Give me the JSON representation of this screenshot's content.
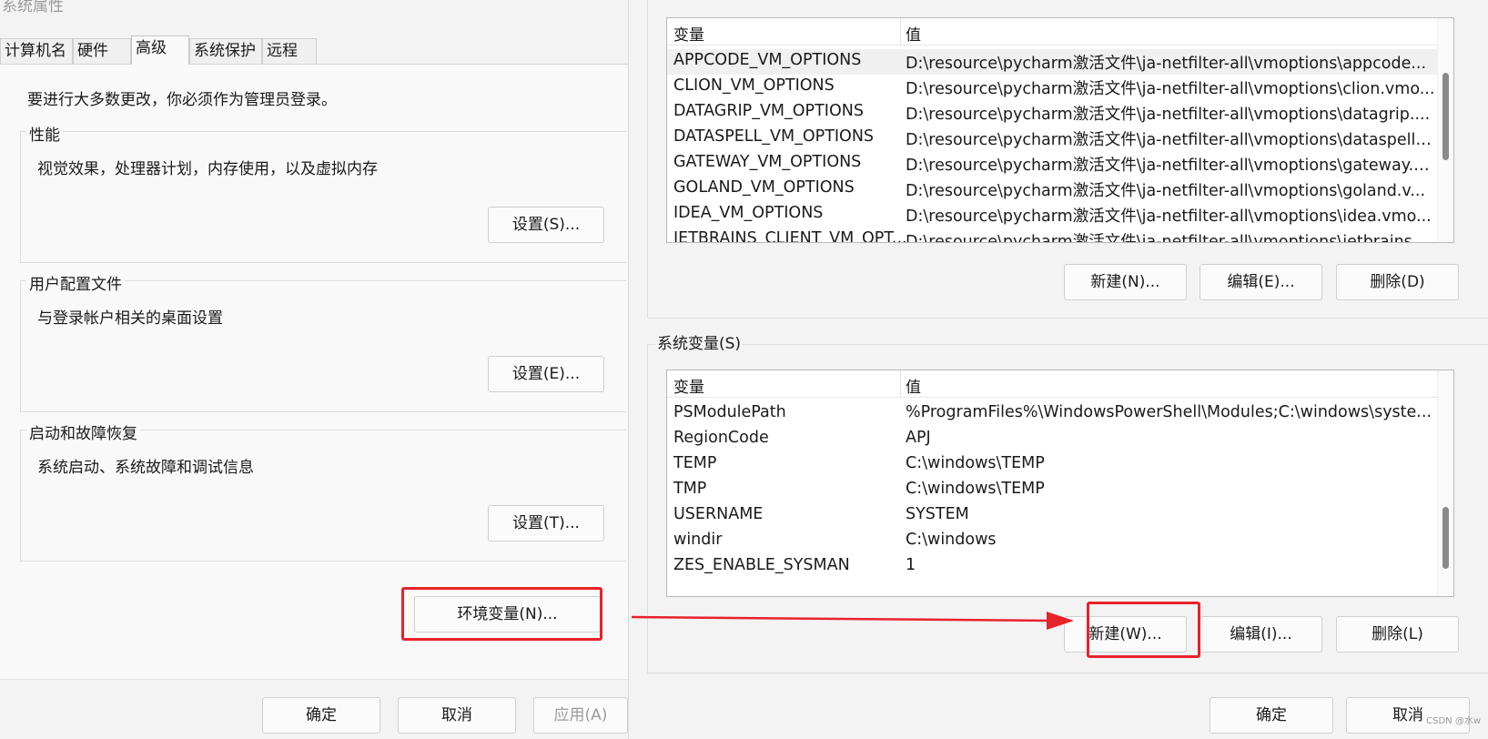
{
  "left_dialog": {
    "title": "系统属性",
    "tabs": [
      {
        "label": "计算机名"
      },
      {
        "label": "硬件"
      },
      {
        "label": "高级"
      },
      {
        "label": "系统保护"
      },
      {
        "label": "远程"
      }
    ],
    "active_tab": "高级",
    "admin_note": "要进行大多数更改，你必须作为管理员登录。",
    "groups": [
      {
        "title": "性能",
        "description": "视觉效果，处理器计划，内存使用，以及虚拟内存",
        "button": "设置(S)..."
      },
      {
        "title": "用户配置文件",
        "description": "与登录帐户相关的桌面设置",
        "button": "设置(E)..."
      },
      {
        "title": "启动和故障恢复",
        "description": "系统启动、系统故障和调试信息",
        "button": "设置(T)..."
      }
    ],
    "env_button": "环境变量(N)...",
    "footer": {
      "ok": "确定",
      "cancel": "取消",
      "apply": "应用(A)"
    }
  },
  "right_dialog": {
    "user_vars": {
      "columns": [
        "变量",
        "值"
      ],
      "rows": [
        {
          "name": "APPCODE_VM_OPTIONS",
          "value": "D:\\resource\\pycharm激活文件\\ja-netfilter-all\\vmoptions\\appcode..."
        },
        {
          "name": "CLION_VM_OPTIONS",
          "value": "D:\\resource\\pycharm激活文件\\ja-netfilter-all\\vmoptions\\clion.vmo..."
        },
        {
          "name": "DATAGRIP_VM_OPTIONS",
          "value": "D:\\resource\\pycharm激活文件\\ja-netfilter-all\\vmoptions\\datagrip...."
        },
        {
          "name": "DATASPELL_VM_OPTIONS",
          "value": "D:\\resource\\pycharm激活文件\\ja-netfilter-all\\vmoptions\\dataspell...."
        },
        {
          "name": "GATEWAY_VM_OPTIONS",
          "value": "D:\\resource\\pycharm激活文件\\ja-netfilter-all\\vmoptions\\gateway.v..."
        },
        {
          "name": "GOLAND_VM_OPTIONS",
          "value": "D:\\resource\\pycharm激活文件\\ja-netfilter-all\\vmoptions\\goland.v..."
        },
        {
          "name": "IDEA_VM_OPTIONS",
          "value": "D:\\resource\\pycharm激活文件\\ja-netfilter-all\\vmoptions\\idea.vmo..."
        },
        {
          "name": "JETBRAINS_CLIENT_VM_OPT...",
          "value": "D:\\resource\\pycharm激活文件\\ja-netfilter-all\\vmoptions\\jetbrains..."
        }
      ],
      "buttons": {
        "new": "新建(N)...",
        "edit": "编辑(E)...",
        "delete": "删除(D)"
      }
    },
    "system_vars": {
      "title": "系统变量(S)",
      "columns": [
        "变量",
        "值"
      ],
      "rows": [
        {
          "name": "PSModulePath",
          "value": "%ProgramFiles%\\WindowsPowerShell\\Modules;C:\\windows\\syste..."
        },
        {
          "name": "RegionCode",
          "value": "APJ"
        },
        {
          "name": "TEMP",
          "value": "C:\\windows\\TEMP"
        },
        {
          "name": "TMP",
          "value": "C:\\windows\\TEMP"
        },
        {
          "name": "USERNAME",
          "value": "SYSTEM"
        },
        {
          "name": "windir",
          "value": "C:\\windows"
        },
        {
          "name": "ZES_ENABLE_SYSMAN",
          "value": "1"
        }
      ],
      "buttons": {
        "new": "新建(W)...",
        "edit": "编辑(I)...",
        "delete": "删除(L)"
      }
    },
    "footer": {
      "ok": "确定",
      "cancel": "取消"
    }
  },
  "annotation": {
    "highlight_color": "#e8222a"
  },
  "watermark": "CSDN @水w"
}
